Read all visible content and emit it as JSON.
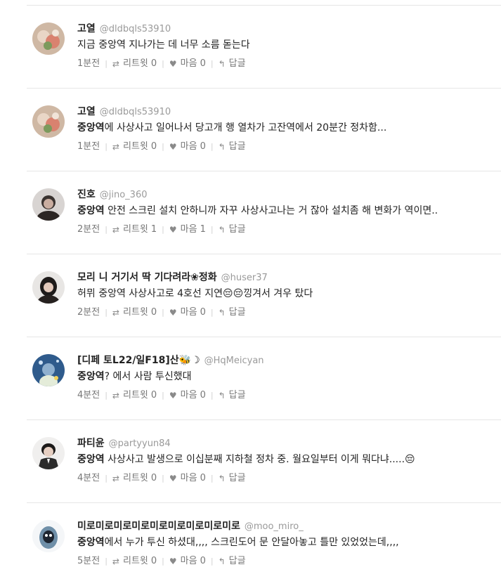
{
  "tweets": [
    {
      "name": "고열",
      "handle": "@dldbqls53910",
      "keyword": "",
      "text": "지금 중앙역 지나가는 데 너무 소름 돋는다",
      "time": "1분전",
      "retweet_label": "리트윗",
      "retweet_count": "0",
      "like_label": "마음",
      "like_count": "0",
      "reply_label": "답글"
    },
    {
      "name": "고열",
      "handle": "@dldbqls53910",
      "keyword": "중앙역",
      "text": "에 사상사고 일어나서 당고개 행 열차가 고잔역에서 20분간 정차함...",
      "time": "1분전",
      "retweet_label": "리트윗",
      "retweet_count": "0",
      "like_label": "마음",
      "like_count": "0",
      "reply_label": "답글"
    },
    {
      "name": "진호",
      "handle": "@jino_360",
      "keyword": "중앙역",
      "text": " 안전 스크린 설치 안하니까 자꾸 사상사고나는 거 잖아 설치좀 해 변화가 역이면..",
      "time": "2분전",
      "retweet_label": "리트윗",
      "retweet_count": "1",
      "like_label": "마음",
      "like_count": "1",
      "reply_label": "답글"
    },
    {
      "name": "모리 니 거기서 딱 기다려라❀정화",
      "handle": "@huser37",
      "keyword": "",
      "text": "허뮈 중앙역 사상사고로 4호선 지연😔😔낑겨서 겨우 탔다",
      "time": "2분전",
      "retweet_label": "리트윗",
      "retweet_count": "0",
      "like_label": "마음",
      "like_count": "0",
      "reply_label": "답글"
    },
    {
      "name": "[디페 토L22/일F18]산🐝☽",
      "handle": "@HqMeicyan",
      "keyword": "중앙역",
      "text": "? 에서 사람 투신했대",
      "time": "4분전",
      "retweet_label": "리트윗",
      "retweet_count": "0",
      "like_label": "마음",
      "like_count": "0",
      "reply_label": "답글"
    },
    {
      "name": "파티윤",
      "handle": "@partyyun84",
      "keyword": "중앙역",
      "text": " 사상사고 발생으로 이십분째 지하철 정차 중. 월요일부터 이게 뭐다냐.....😔",
      "time": "4분전",
      "retweet_label": "리트윗",
      "retweet_count": "0",
      "like_label": "마음",
      "like_count": "0",
      "reply_label": "답글"
    },
    {
      "name": "미로미로미로미로미로미로미로미로미로",
      "handle": "@moo_miro_",
      "keyword": "중앙역",
      "text": "에서 누가 투신 하셨대,,,, 스크린도어 문 안달아놓고 틀만 있었었는데,,,,",
      "time": "5분전",
      "retweet_label": "리트윗",
      "retweet_count": "0",
      "like_label": "마음",
      "like_count": "0",
      "reply_label": "답글"
    }
  ],
  "icons": {
    "retweet": "retweet-icon",
    "like": "heart-icon",
    "reply": "reply-arrow-icon"
  },
  "colors": {
    "text": "#222222",
    "muted": "#777777",
    "handle": "#9a9a9a",
    "divider": "#e6e6e6"
  }
}
